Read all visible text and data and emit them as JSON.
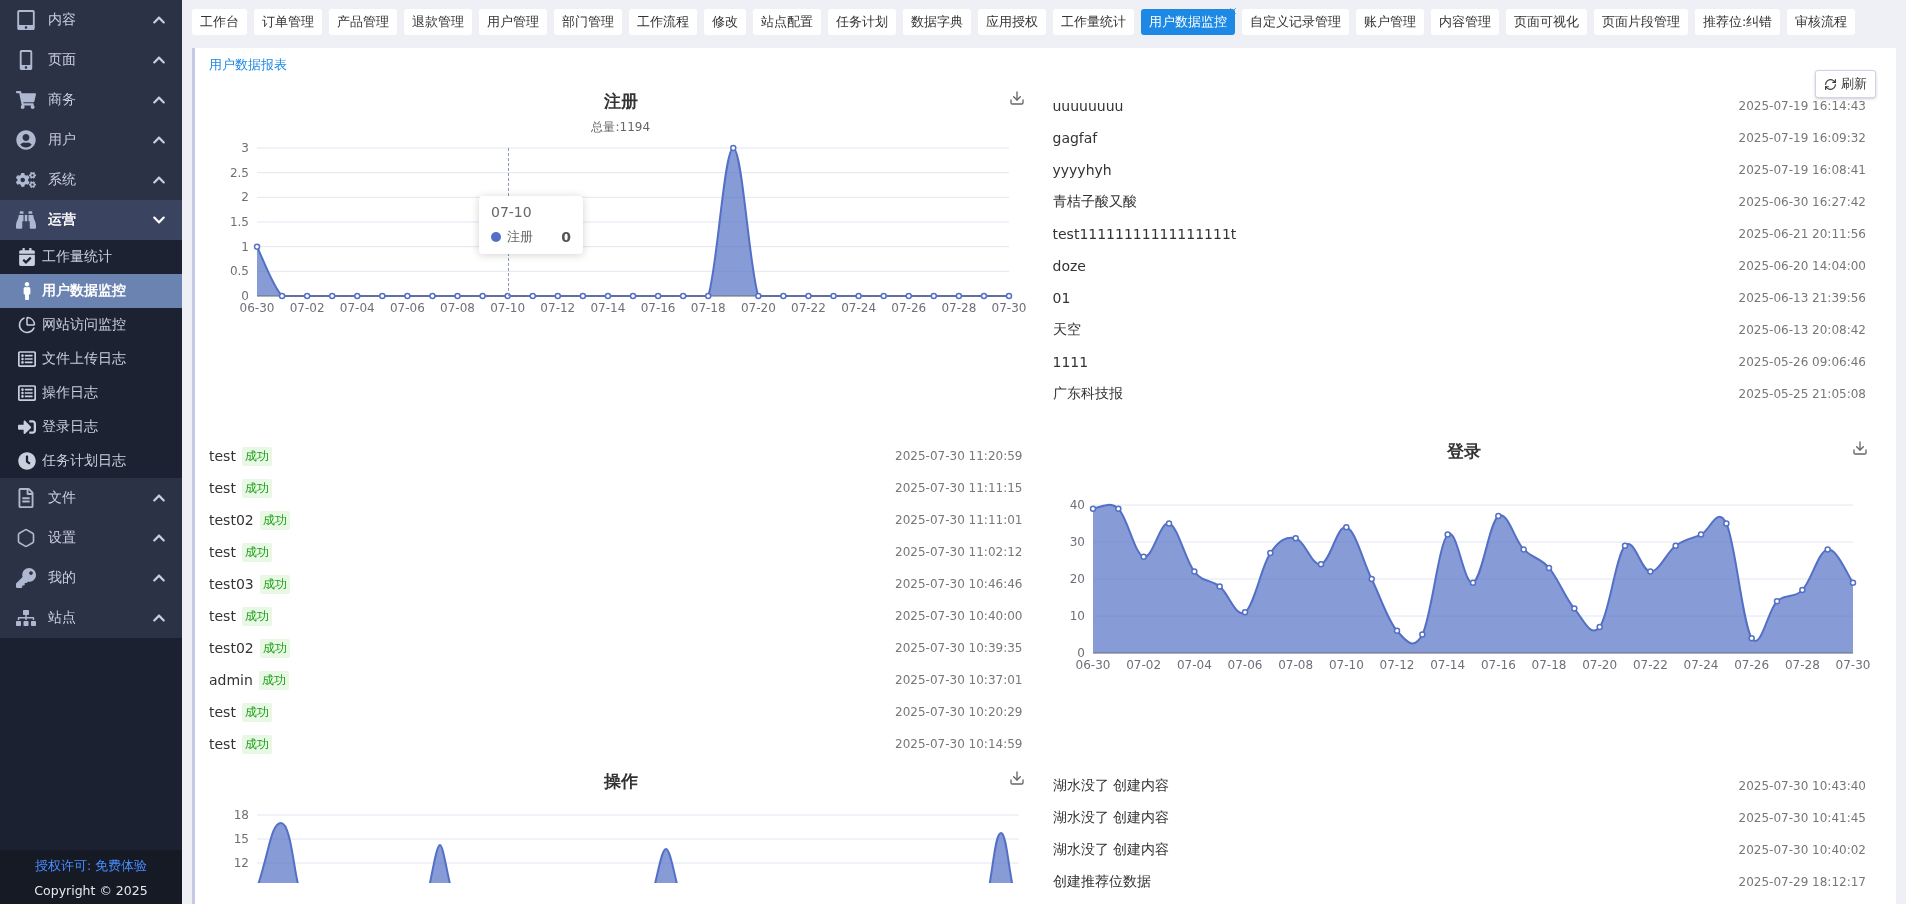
{
  "sidebar": {
    "groups": [
      {
        "label": "内容",
        "expanded": false
      },
      {
        "label": "页面",
        "expanded": false
      },
      {
        "label": "商务",
        "expanded": false
      },
      {
        "label": "用户",
        "expanded": false
      },
      {
        "label": "系统",
        "expanded": false
      },
      {
        "label": "运营",
        "expanded": true,
        "children": [
          {
            "label": "工作量统计",
            "selected": false
          },
          {
            "label": "用户数据监控",
            "selected": true
          },
          {
            "label": "网站访问监控",
            "selected": false
          },
          {
            "label": "文件上传日志",
            "selected": false
          },
          {
            "label": "操作日志",
            "selected": false
          },
          {
            "label": "登录日志",
            "selected": false
          },
          {
            "label": "任务计划日志",
            "selected": false
          }
        ]
      },
      {
        "label": "文件",
        "expanded": false
      },
      {
        "label": "设置",
        "expanded": false
      },
      {
        "label": "我的",
        "expanded": false
      },
      {
        "label": "站点",
        "expanded": false
      }
    ],
    "license": "授权许可: 免费体验",
    "copyright": "Copyright © 2025"
  },
  "tabs": [
    {
      "label": "工作台",
      "selected": false
    },
    {
      "label": "订单管理",
      "selected": false
    },
    {
      "label": "产品管理",
      "selected": false
    },
    {
      "label": "退款管理",
      "selected": false
    },
    {
      "label": "用户管理",
      "selected": false
    },
    {
      "label": "部门管理",
      "selected": false
    },
    {
      "label": "工作流程",
      "selected": false
    },
    {
      "label": "修改",
      "selected": false
    },
    {
      "label": "站点配置",
      "selected": false
    },
    {
      "label": "任务计划",
      "selected": false
    },
    {
      "label": "数据字典",
      "selected": false
    },
    {
      "label": "应用授权",
      "selected": false
    },
    {
      "label": "工作量统计",
      "selected": false
    },
    {
      "label": "用户数据监控",
      "selected": true
    },
    {
      "label": "自定义记录管理",
      "selected": false
    },
    {
      "label": "账户管理",
      "selected": false
    },
    {
      "label": "内容管理",
      "selected": false
    },
    {
      "label": "页面可视化",
      "selected": false
    },
    {
      "label": "页面片段管理",
      "selected": false
    },
    {
      "label": "推荐位:纠错",
      "selected": false
    },
    {
      "label": "审核流程",
      "selected": false
    }
  ],
  "report": {
    "title": "用户数据报表",
    "refresh": "刷新"
  },
  "register": {
    "subtitle": "总量:1194",
    "tooltip": {
      "x": "07-10",
      "value": "0"
    },
    "chart_data": {
      "type": "area",
      "title": "注册",
      "grid": true,
      "categories": [
        "06-30",
        null,
        "07-02",
        null,
        "07-04",
        null,
        "07-06",
        null,
        "07-08",
        null,
        "07-10",
        null,
        "07-12",
        null,
        "07-14",
        null,
        "07-16",
        null,
        "07-18",
        null,
        "07-20",
        null,
        "07-22",
        null,
        "07-24",
        null,
        "07-26",
        null,
        "07-28",
        null,
        "07-30"
      ],
      "series": [
        {
          "name": "注册",
          "color": "#5470c6",
          "values": [
            1,
            0,
            0,
            0,
            0,
            0,
            0,
            0,
            0,
            0,
            0,
            0,
            0,
            0,
            0,
            0,
            0,
            0,
            0,
            3,
            0,
            0,
            0,
            0,
            0,
            0,
            0,
            0,
            0,
            0,
            0
          ]
        }
      ],
      "ylim": [
        0,
        3
      ],
      "yticks": [
        0,
        0.5,
        1,
        1.5,
        2,
        2.5,
        3
      ]
    }
  },
  "new_users": [
    {
      "name": "uuuuuuuu",
      "time": "2025-07-19 16:14:43"
    },
    {
      "name": "gagfaf",
      "time": "2025-07-19 16:09:32"
    },
    {
      "name": "yyyyhyh",
      "time": "2025-07-19 16:08:41"
    },
    {
      "name": "青桔子酸又酸",
      "time": "2025-06-30 16:27:42"
    },
    {
      "name": "test11111111111111111t",
      "time": "2025-06-21 20:11:56"
    },
    {
      "name": "doze",
      "time": "2025-06-20 14:04:00"
    },
    {
      "name": "01",
      "time": "2025-06-13 21:39:56"
    },
    {
      "name": "天空",
      "time": "2025-06-13 20:08:42"
    },
    {
      "name": "1111",
      "time": "2025-05-26 09:06:46"
    },
    {
      "name": "广东科技报",
      "time": "2025-05-25 21:05:08"
    }
  ],
  "logins": [
    {
      "name": "test",
      "status": "成功",
      "time": "2025-07-30 11:20:59"
    },
    {
      "name": "test",
      "status": "成功",
      "time": "2025-07-30 11:11:15"
    },
    {
      "name": "test02",
      "status": "成功",
      "time": "2025-07-30 11:11:01"
    },
    {
      "name": "test",
      "status": "成功",
      "time": "2025-07-30 11:02:12"
    },
    {
      "name": "test03",
      "status": "成功",
      "time": "2025-07-30 10:46:46"
    },
    {
      "name": "test",
      "status": "成功",
      "time": "2025-07-30 10:40:00"
    },
    {
      "name": "test02",
      "status": "成功",
      "time": "2025-07-30 10:39:35"
    },
    {
      "name": "admin",
      "status": "成功",
      "time": "2025-07-30 10:37:01"
    },
    {
      "name": "test",
      "status": "成功",
      "time": "2025-07-30 10:20:29"
    },
    {
      "name": "test",
      "status": "成功",
      "time": "2025-07-30 10:14:59"
    }
  ],
  "login_chart": {
    "chart_data": {
      "type": "area",
      "title": "登录",
      "grid": true,
      "categories": [
        "06-30",
        null,
        "07-02",
        null,
        "07-04",
        null,
        "07-06",
        null,
        "07-08",
        null,
        "07-10",
        null,
        "07-12",
        null,
        "07-14",
        null,
        "07-16",
        null,
        "07-18",
        null,
        "07-20",
        null,
        "07-22",
        null,
        "07-24",
        null,
        "07-26",
        null,
        "07-28",
        null,
        "07-30"
      ],
      "series": [
        {
          "color": "#5470c6",
          "values": [
            39,
            39,
            26,
            35,
            22,
            18,
            11,
            27,
            31,
            24,
            34,
            20,
            6,
            5,
            32,
            19,
            37,
            28,
            23,
            12,
            7,
            29,
            22,
            29,
            32,
            35,
            4,
            14,
            17,
            28,
            19
          ]
        }
      ],
      "ylim": [
        0,
        40
      ],
      "yticks": [
        0,
        10,
        20,
        30,
        40
      ]
    }
  },
  "operations_chart": {
    "title": "操作",
    "y_tick_labels": [
      "18",
      "15",
      "12"
    ]
  },
  "operations": [
    {
      "text": "湖水没了 创建内容",
      "time": "2025-07-30 10:43:40"
    },
    {
      "text": "湖水没了 创建内容",
      "time": "2025-07-30 10:41:45"
    },
    {
      "text": "湖水没了 创建内容",
      "time": "2025-07-30 10:40:02"
    },
    {
      "text": "创建推荐位数据",
      "time": "2025-07-29 18:12:17"
    }
  ]
}
